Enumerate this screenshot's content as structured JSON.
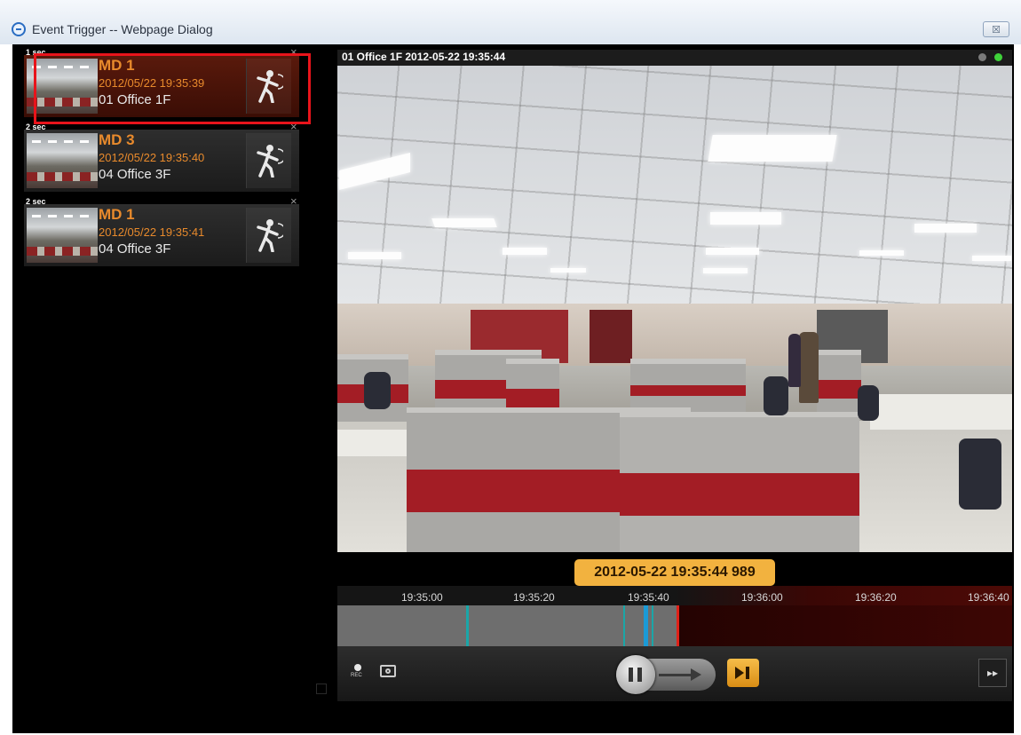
{
  "window": {
    "title": "Event Trigger -- Webpage Dialog",
    "close_label": "☒"
  },
  "events": [
    {
      "duration": "1 sec",
      "name": "MD 1",
      "time": "2012/05/22 19:35:39",
      "camera": "01 Office 1F",
      "selected": true
    },
    {
      "duration": "2 sec",
      "name": "MD 3",
      "time": "2012/05/22 19:35:40",
      "camera": "04 Office 3F",
      "selected": false
    },
    {
      "duration": "2 sec",
      "name": "MD 1",
      "time": "2012/05/22 19:35:41",
      "camera": "04 Office 3F",
      "selected": false
    }
  ],
  "viewer": {
    "header": "01 Office 1F  2012-05-22 19:35:44",
    "timestamp": "2012-05-22 19:35:44 989"
  },
  "timeline": {
    "ticks": [
      "19:35:00",
      "19:35:20",
      "19:35:40",
      "19:36:00",
      "19:36:20",
      "19:36:40"
    ]
  },
  "controls": {
    "rec_label": "REC",
    "fast_label": "▸▸"
  },
  "icons": {
    "motion": "motion-detect-icon",
    "camera": "snapshot-icon",
    "close": "close-icon"
  },
  "colors": {
    "accent": "#f2b23f",
    "highlight": "#e8141b",
    "event_text": "#e88a2c"
  }
}
